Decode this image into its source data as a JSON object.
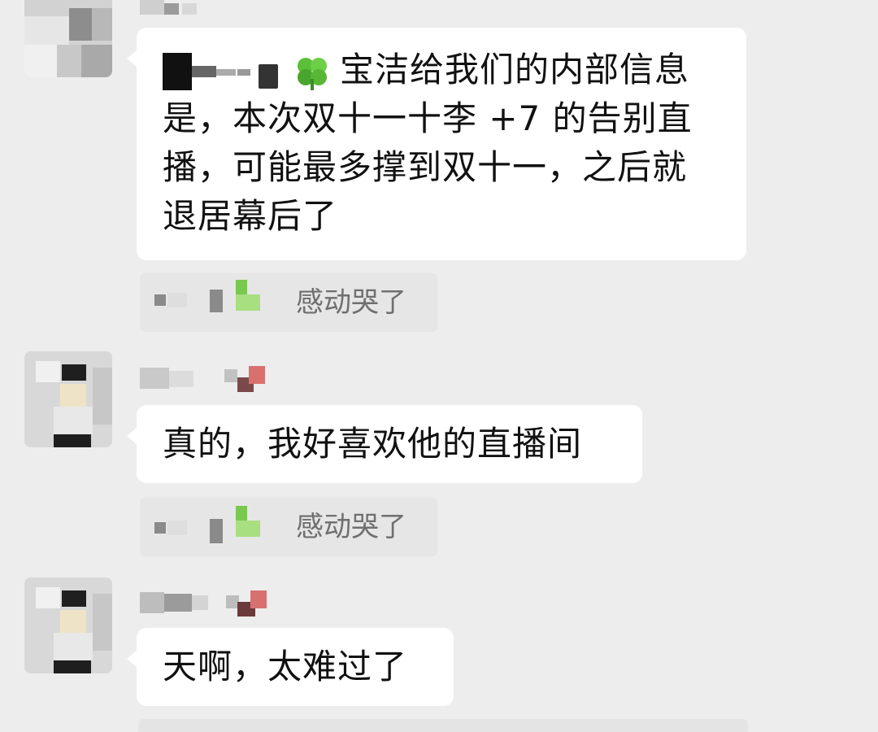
{
  "messages": [
    {
      "text_after_name": "宝洁给我们的内部信息是，本次双十一十李 +7 的告别直播，可能最多撑到双十一，之后就退居幕后了",
      "lines": [
        "宝洁给我们的内部信息",
        "是，本次双十一十李 +7 的告别直",
        "播，可能最多撑到双十一，之后就",
        "退居幕后了"
      ]
    },
    {
      "text": "真的，我好喜欢他的直播间"
    },
    {
      "text": "天啊，太难过了"
    }
  ],
  "reactions": [
    {
      "text": "感动哭了"
    },
    {
      "text": "感动哭了"
    }
  ],
  "icons": {
    "clover": "four-leaf-clover-icon"
  },
  "colors": {
    "background": "#ededed",
    "bubble": "#ffffff",
    "reaction_bg": "#e6e6e6",
    "reaction_text": "#6f6f6f",
    "clover_green": "#5bbf3a"
  }
}
